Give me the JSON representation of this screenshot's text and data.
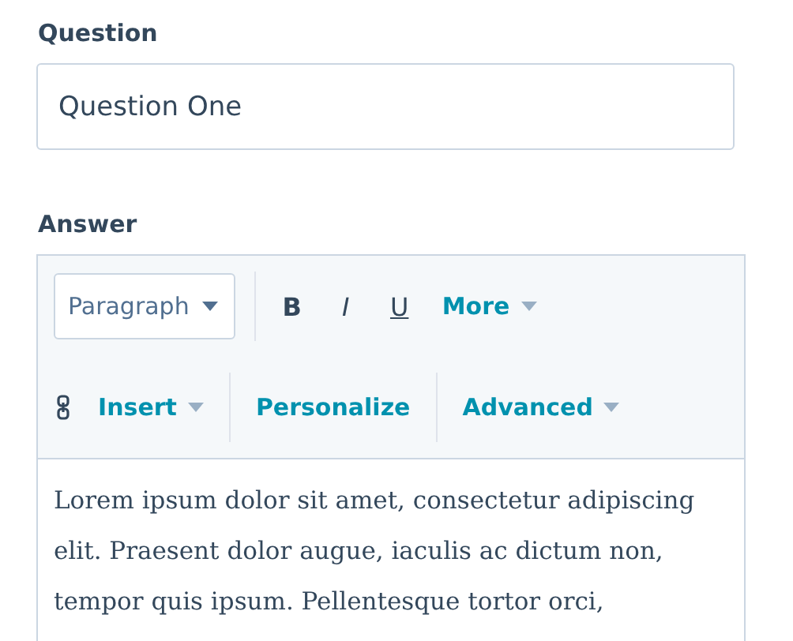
{
  "question": {
    "label": "Question",
    "value": "Question One"
  },
  "answer": {
    "label": "Answer",
    "toolbar": [
      [
        {
          "kind": "select",
          "label": "Paragraph"
        },
        {
          "kind": "divider"
        },
        {
          "kind": "bold",
          "label": "B"
        },
        {
          "kind": "italic",
          "label": "I"
        },
        {
          "kind": "underline",
          "label": "U"
        },
        {
          "kind": "menu",
          "label": "More"
        }
      ],
      [
        {
          "kind": "link"
        },
        {
          "kind": "menu",
          "label": "Insert"
        },
        {
          "kind": "divider"
        },
        {
          "kind": "action",
          "label": "Personalize"
        },
        {
          "kind": "divider"
        },
        {
          "kind": "menu",
          "label": "Advanced"
        }
      ]
    ],
    "body": "Lorem ipsum dolor sit amet, consectetur adipiscing elit. Praesent dolor augue, iaculis ac dictum non, tempor quis ipsum. Pellentesque tortor orci,"
  }
}
